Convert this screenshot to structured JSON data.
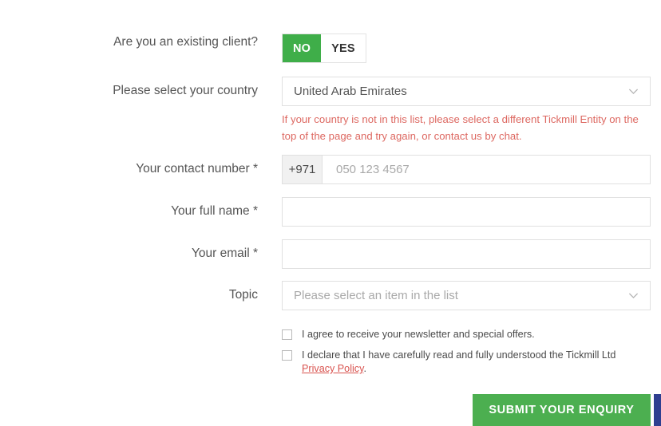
{
  "form": {
    "existing_client": {
      "label": "Are you an existing client?",
      "options": [
        {
          "label": "NO",
          "selected": true
        },
        {
          "label": "YES",
          "selected": false
        }
      ]
    },
    "country": {
      "label": "Please select your country",
      "value": "United Arab Emirates",
      "chevron_icon": "chevron-down-icon",
      "error": "If your country is not in this list, please select a different Tickmill Entity on the top of the page and try again, or contact us by chat."
    },
    "contact_number": {
      "label": "Your contact number *",
      "prefix": "+971",
      "placeholder": "050 123 4567",
      "value": ""
    },
    "full_name": {
      "label": "Your full name *",
      "placeholder": "",
      "value": ""
    },
    "email": {
      "label": "Your email *",
      "placeholder": "",
      "value": ""
    },
    "topic": {
      "label": "Topic",
      "placeholder": "Please select an item in the list",
      "value": "",
      "chevron_icon": "chevron-down-icon"
    },
    "consents": [
      {
        "text": "I agree to receive your newsletter and special offers.",
        "checked": false
      }
    ],
    "declaration": {
      "text_before": "I declare that I have carefully read and fully understood the Tickmill Ltd ",
      "link_text": "Privacy Policy",
      "text_after": ".",
      "checked": false
    },
    "submit_label": "SUBMIT YOUR ENQUIRY"
  },
  "colors": {
    "accent_green": "#4caf50",
    "toggle_green": "#3fae49",
    "error_red": "#dd6861",
    "link_red": "#d9534f",
    "chat_blue": "#2f3f90",
    "label_gray": "#555555",
    "border_gray": "#e0e0e0"
  }
}
